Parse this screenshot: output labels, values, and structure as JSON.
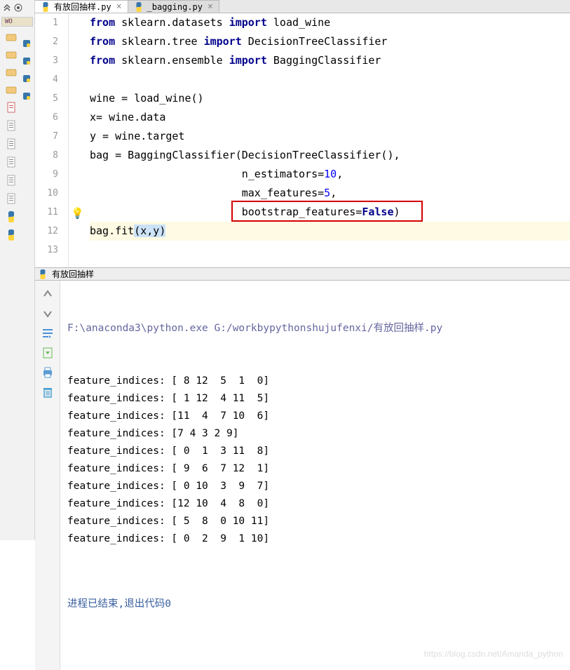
{
  "tabs": [
    {
      "label": "有放回抽样.py",
      "active": true
    },
    {
      "label": "_bagging.py",
      "active": false
    }
  ],
  "sidebar": {
    "worktag": "WO"
  },
  "code": {
    "lines": [
      {
        "n": "1",
        "tokens": [
          [
            "kw",
            "from "
          ],
          [
            "id",
            "sklearn.datasets "
          ],
          [
            "kw",
            "import "
          ],
          [
            "id",
            "load_wine"
          ]
        ]
      },
      {
        "n": "2",
        "tokens": [
          [
            "kw",
            "from "
          ],
          [
            "id",
            "sklearn.tree "
          ],
          [
            "kw",
            "import "
          ],
          [
            "id",
            "DecisionTreeClassifier"
          ]
        ]
      },
      {
        "n": "3",
        "tokens": [
          [
            "kw",
            "from "
          ],
          [
            "id",
            "sklearn.ensemble "
          ],
          [
            "kw",
            "import "
          ],
          [
            "id",
            "BaggingClassifier"
          ]
        ]
      },
      {
        "n": "4",
        "tokens": []
      },
      {
        "n": "5",
        "tokens": [
          [
            "id",
            "wine = load_wine()"
          ]
        ]
      },
      {
        "n": "6",
        "tokens": [
          [
            "id",
            "x= wine.data"
          ]
        ]
      },
      {
        "n": "7",
        "tokens": [
          [
            "id",
            "y = wine.target"
          ]
        ]
      },
      {
        "n": "8",
        "tokens": [
          [
            "id",
            "bag = BaggingClassifier(DecisionTreeClassifier(),"
          ]
        ]
      },
      {
        "n": "9",
        "tokens": [
          [
            "pad",
            "                        "
          ],
          [
            "id",
            "n_estimators="
          ],
          [
            "num",
            "10"
          ],
          [
            "id",
            ","
          ]
        ]
      },
      {
        "n": "10",
        "tokens": [
          [
            "pad",
            "                        "
          ],
          [
            "id",
            "max_features="
          ],
          [
            "num",
            "5"
          ],
          [
            "id",
            ","
          ]
        ]
      },
      {
        "n": "11",
        "tokens": [
          [
            "pad",
            "                        "
          ],
          [
            "id",
            "bootstrap_features="
          ],
          [
            "kw2",
            "False"
          ],
          [
            "id",
            ")"
          ]
        ],
        "redbox": true
      },
      {
        "n": "12",
        "tokens": [
          [
            "id",
            "bag.fit"
          ],
          [
            "caret",
            "(x,y)"
          ]
        ],
        "active": true
      },
      {
        "n": "13",
        "tokens": []
      }
    ]
  },
  "console": {
    "tab_label": "有放回抽样",
    "cmdline": "F:\\anaconda3\\python.exe G:/workbypythonshujufenxi/有放回抽样.py",
    "output_lines": [
      "feature_indices: [ 8 12  5  1  0]",
      "feature_indices: [ 1 12  4 11  5]",
      "feature_indices: [11  4  7 10  6]",
      "feature_indices: [7 4 3 2 9]",
      "feature_indices: [ 0  1  3 11  8]",
      "feature_indices: [ 9  6  7 12  1]",
      "feature_indices: [ 0 10  3  9  7]",
      "feature_indices: [12 10  4  8  0]",
      "feature_indices: [ 5  8  0 10 11]",
      "feature_indices: [ 0  2  9  1 10]"
    ],
    "exit_msg": "进程已结束,退出代码0"
  },
  "watermark": "https://blog.csdn.net/Amanda_python"
}
